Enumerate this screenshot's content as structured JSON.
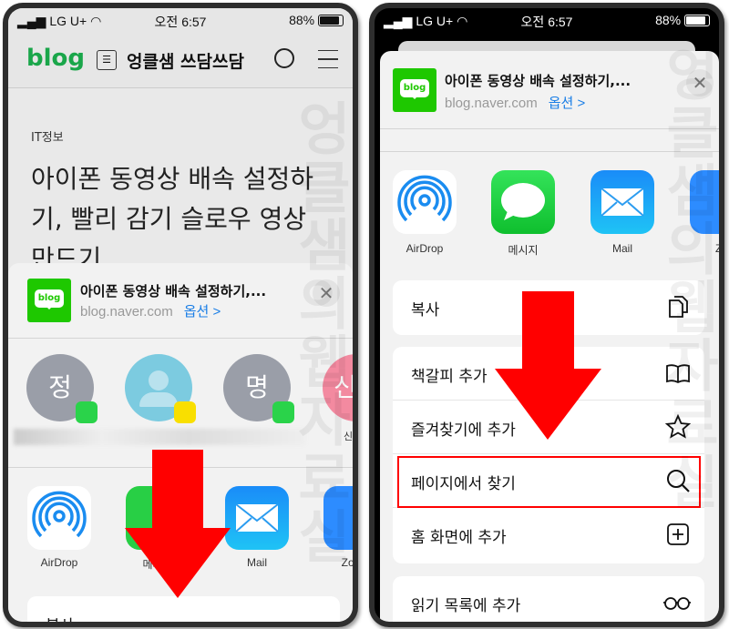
{
  "status_bar": {
    "carrier": "LG U+",
    "time": "오전 6:57",
    "battery": "88%"
  },
  "left": {
    "header": {
      "logo": "blog",
      "blog_name": "엉클샘 쓰담쓰담"
    },
    "article": {
      "category": "IT정보",
      "title_lines": [
        "아이폰 동영상 배속 설정하",
        "기, 빨리 감기 슬로우 영상",
        "만드기"
      ]
    },
    "share": {
      "title": "아이폰 동영상 배속 설정하기,...",
      "url": "blog.naver.com",
      "options": "옵션 >",
      "close": "✕",
      "contacts": [
        {
          "initial": "정",
          "badge": "messages"
        },
        {
          "initial": "",
          "badge": "kakaotalk"
        },
        {
          "initial": "명",
          "badge": "messages"
        },
        {
          "initial": "신",
          "label": "신"
        }
      ],
      "apps": [
        {
          "label": "AirDrop"
        },
        {
          "label": "메시지"
        },
        {
          "label": "Mail"
        },
        {
          "label": "Zoom"
        }
      ],
      "first_action": "복사"
    }
  },
  "right": {
    "share": {
      "title": "아이폰 동영상 배속 설정하기,...",
      "url": "blog.naver.com",
      "options": "옵션 >",
      "close": "✕",
      "apps": [
        {
          "label": "AirDrop"
        },
        {
          "label": "메시지"
        },
        {
          "label": "Mail"
        },
        {
          "label": "Zo"
        }
      ],
      "actions": [
        {
          "label": "복사",
          "icon": "copy-icon"
        },
        {
          "label": "책갈피 추가",
          "icon": "book-icon"
        },
        {
          "label": "즐겨찾기에 추가",
          "icon": "star-icon"
        },
        {
          "label": "페이지에서 찾기",
          "icon": "search-icon",
          "highlighted": true
        },
        {
          "label": "홈 화면에 추가",
          "icon": "add-square-icon"
        },
        {
          "label": "읽기 목록에 추가",
          "icon": "glasses-icon"
        }
      ]
    }
  },
  "watermark": "엉클샘의웹자료실",
  "colors": {
    "brand_green": "#1ec800",
    "link_blue": "#1a7ee6",
    "annotation_red": "#ff0000"
  }
}
